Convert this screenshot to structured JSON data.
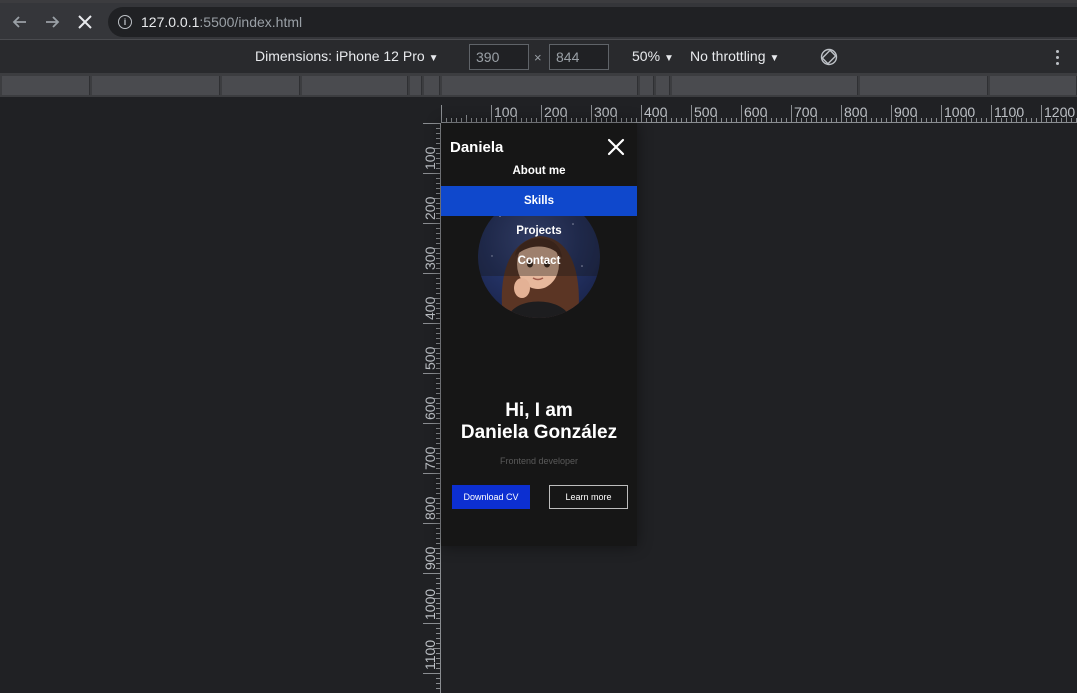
{
  "browser": {
    "url_host": "127.0.0.1",
    "url_path": ":5500/index.html"
  },
  "device_toolbar": {
    "dimensions_label": "Dimensions: iPhone 12 Pro",
    "width_value": "390",
    "height_value": "844",
    "separator": "×",
    "zoom": "50%",
    "throttling": "No throttling"
  },
  "rulers": {
    "horizontal_ticks": [
      "100",
      "200",
      "300",
      "400",
      "500",
      "600",
      "700",
      "800",
      "900",
      "1000",
      "1100",
      "1200"
    ],
    "vertical_ticks": [
      "100",
      "200",
      "300",
      "400",
      "500",
      "600",
      "700",
      "800",
      "900",
      "1000",
      "1100"
    ]
  },
  "site": {
    "brand": "Daniela",
    "menu": [
      {
        "label": "About me",
        "active": false
      },
      {
        "label": "Skills",
        "active": true
      },
      {
        "label": "Projects",
        "active": false
      },
      {
        "label": "Contact",
        "active": false
      }
    ],
    "hero_line1": "Hi, I am",
    "hero_line2": "Daniela González",
    "subtitle": "Frontend developer",
    "primary_button": "Download CV",
    "secondary_button": "Learn more"
  },
  "colors": {
    "accent_blue": "#0f48cc",
    "button_blue": "#0c2fd1",
    "page_bg": "#161616"
  }
}
